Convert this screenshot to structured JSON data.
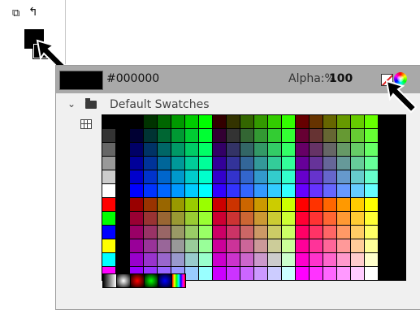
{
  "tools": {
    "swap_icon": "swap-colors-icon",
    "reset_icon": "reset-colors-icon",
    "fill_color": "#000000",
    "stroke_color": "#000000"
  },
  "panel": {
    "hex_value": "#000000",
    "alpha_label": "Alpha:%",
    "alpha_value": "100",
    "nocolor_icon": "no-color-icon",
    "wheel_icon": "color-wheel-icon"
  },
  "swatches": {
    "folder_label": "Default Swatches",
    "left_column": [
      "#000000",
      "#333333",
      "#666666",
      "#999999",
      "#cccccc",
      "#ffffff",
      "#ff0000",
      "#00ff00",
      "#0000ff",
      "#ffff00",
      "#00ffff",
      "#ff00ff"
    ],
    "gradients": [
      "linear-gradient(90deg,#000,#fff)",
      "radial-gradient(#fff,#000)",
      "radial-gradient(#ff0000,#000)",
      "radial-gradient(#00ff00,#000)",
      "radial-gradient(#0000ff,#000)",
      "linear-gradient(90deg,#ff0000,#ffff00,#00ff00,#00ffff,#0000ff,#ff00ff,#ff0000)"
    ]
  }
}
